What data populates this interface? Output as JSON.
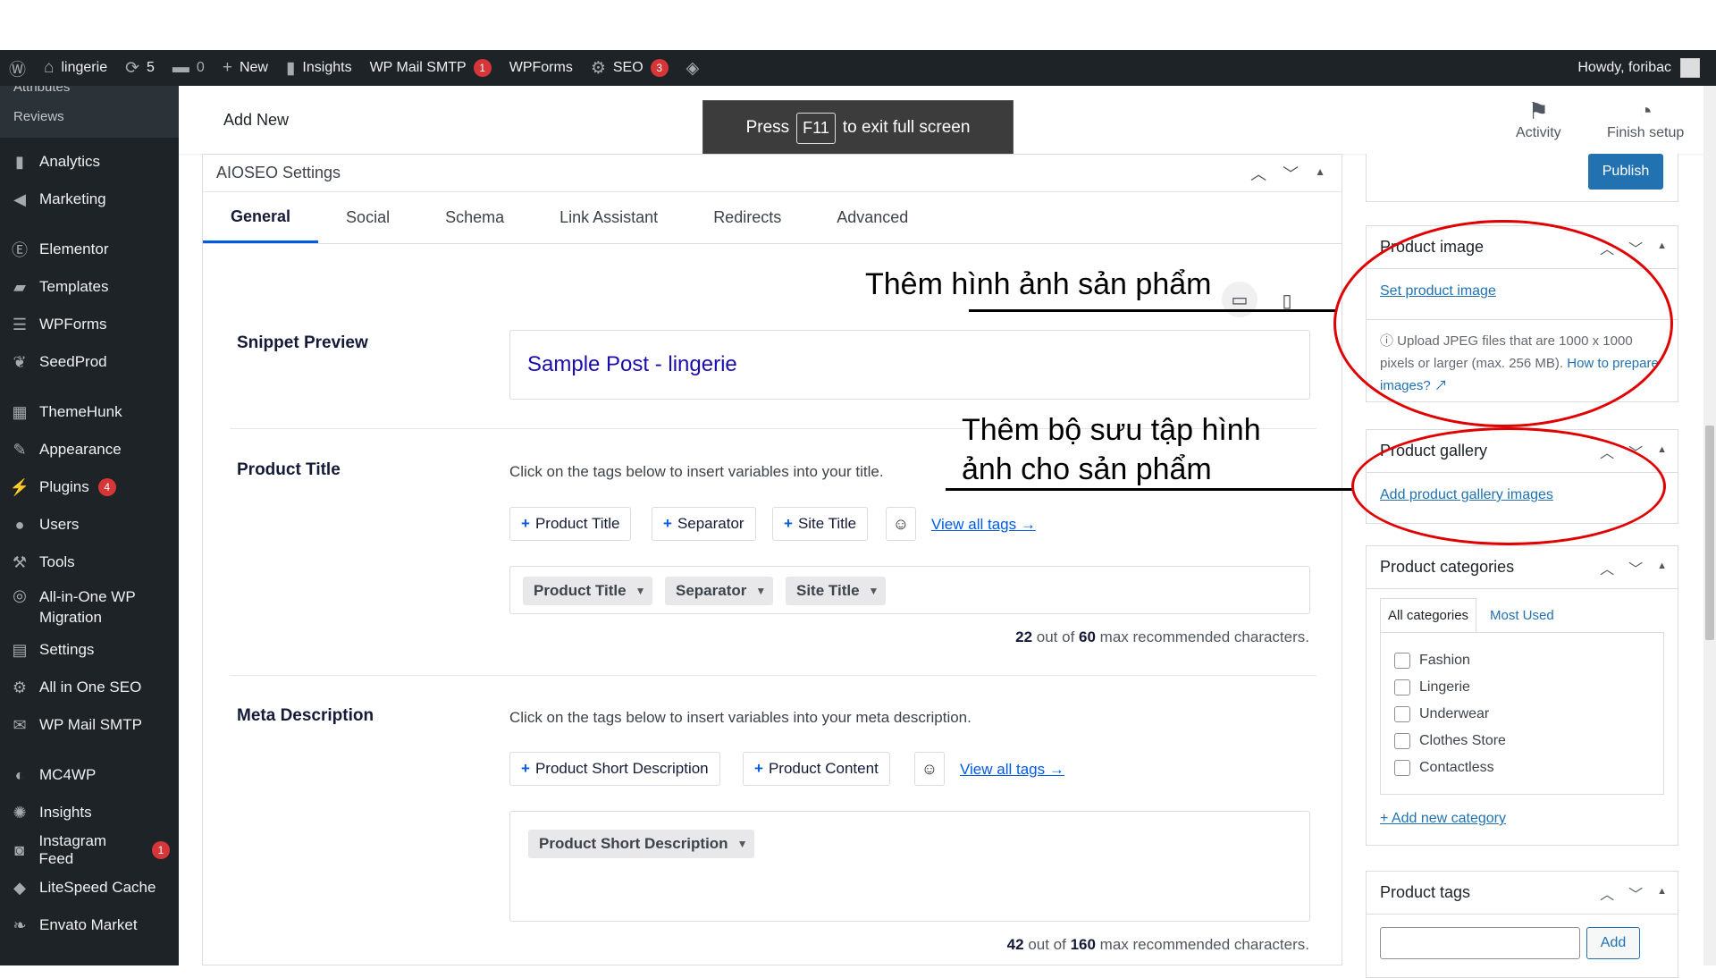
{
  "adminbar": {
    "site_name": "lingerie",
    "updates_count": "5",
    "comments_count": "0",
    "new_label": "New",
    "insights_label": "Insights",
    "wp_mail_smtp_label": "WP Mail SMTP",
    "wp_mail_smtp_badge": "1",
    "wpforms_label": "WPForms",
    "seo_label": "SEO",
    "seo_badge": "3",
    "howdy": "Howdy, foribac"
  },
  "sidebar": {
    "sub_attributes": "Attributes",
    "sub_reviews": "Reviews",
    "items": [
      {
        "label": "Analytics"
      },
      {
        "label": "Marketing"
      },
      {
        "label": "Elementor"
      },
      {
        "label": "Templates"
      },
      {
        "label": "WPForms"
      },
      {
        "label": "SeedProd"
      },
      {
        "label": "ThemeHunk"
      },
      {
        "label": "Appearance"
      },
      {
        "label": "Plugins",
        "badge": "4"
      },
      {
        "label": "Users"
      },
      {
        "label": "Tools"
      },
      {
        "label": "All-in-One WP",
        "label2": "Migration"
      },
      {
        "label": "Settings"
      },
      {
        "label": "All in One SEO"
      },
      {
        "label": "WP Mail SMTP"
      },
      {
        "label": "MC4WP"
      },
      {
        "label": "Insights"
      },
      {
        "label": "Instagram Feed",
        "badge": "1"
      },
      {
        "label": "LiteSpeed Cache"
      },
      {
        "label": "Envato Market"
      }
    ]
  },
  "header": {
    "title": "Add New",
    "activity_label": "Activity",
    "finish_setup_label": "Finish setup"
  },
  "fullscreen_notice": {
    "press": "Press",
    "key": "F11",
    "rest": "to exit full screen"
  },
  "aioseo": {
    "title": "AIOSEO Settings",
    "tabs": [
      "General",
      "Social",
      "Schema",
      "Link Assistant",
      "Redirects",
      "Advanced"
    ],
    "snippet_label": "Snippet Preview",
    "snippet_title": "Sample Post - lingerie",
    "product_title": {
      "label": "Product Title",
      "desc": "Click on the tags below to insert variables into your title.",
      "tags": [
        "Product Title",
        "Separator",
        "Site Title"
      ],
      "view_all": "View all tags →",
      "chips": [
        "Product Title",
        "Separator",
        "Site Title"
      ],
      "count": "22",
      "count_mid": " out of ",
      "max": "60",
      "count_suffix": " max recommended characters."
    },
    "meta": {
      "label": "Meta Description",
      "desc": "Click on the tags below to insert variables into your meta description.",
      "tags": [
        "Product Short Description",
        "Product Content"
      ],
      "view_all": "View all tags →",
      "chips": [
        "Product Short Description"
      ],
      "count": "42",
      "count_mid": " out of ",
      "max": "160",
      "count_suffix": " max recommended characters."
    }
  },
  "annotations": {
    "image_note": "Thêm hình ảnh sản phẩm",
    "gallery_note_line1": "Thêm bộ sưu tập hình",
    "gallery_note_line2": "ảnh cho sản phẩm"
  },
  "right": {
    "publish_label": "Publish",
    "product_image": {
      "title": "Product image",
      "link": "Set product image",
      "help": "Upload JPEG files that are 1000 x 1000 pixels or larger (max. 256 MB).",
      "help_link": "How to prepare images?"
    },
    "product_gallery": {
      "title": "Product gallery",
      "link": "Add product gallery images"
    },
    "categories": {
      "title": "Product categories",
      "tab_all": "All categories",
      "tab_most": "Most Used",
      "items": [
        "Fashion",
        "Lingerie",
        "Underwear",
        "Clothes Store",
        "Contactless"
      ],
      "add_new": "+ Add new category"
    },
    "tags": {
      "title": "Product tags",
      "add_label": "Add"
    }
  },
  "colors": {
    "admin_dark": "#1d2327",
    "accent_blue": "#005ae0",
    "wp_blue": "#2271b1",
    "annotation_red": "#e00000"
  }
}
